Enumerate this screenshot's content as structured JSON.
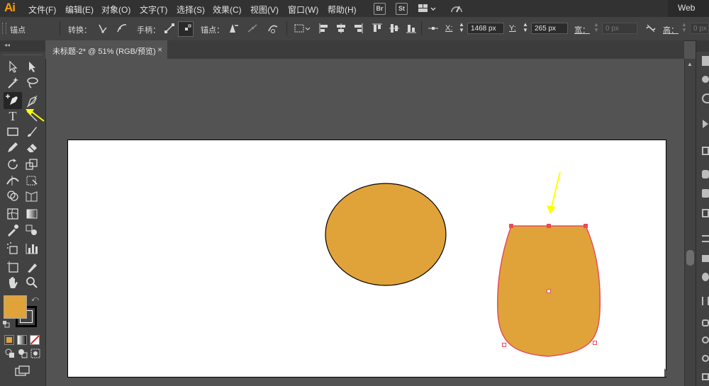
{
  "app": {
    "logo": "Ai",
    "workspace": "Web"
  },
  "menu": [
    "文件(F)",
    "编辑(E)",
    "对象(O)",
    "文字(T)",
    "选择(S)",
    "效果(C)",
    "视图(V)",
    "窗口(W)",
    "帮助(H)"
  ],
  "menubar_icons": {
    "bridge": "Br",
    "stock": "St"
  },
  "control": {
    "selection_label": "锚点",
    "convert_label": "转换：",
    "handles_label": "手柄：",
    "anchors_label": "锚点：",
    "x_label": "X:",
    "x_value": "1468 px",
    "y_label": "Y:",
    "y_value": "265 px",
    "w_label": "宽：",
    "w_value": "0 px",
    "h_label": "高：",
    "h_value": "0 px"
  },
  "document": {
    "tab_title": "未标题-2* @ 51% (RGB/预览)"
  },
  "colors": {
    "fill": "#E0A33A",
    "stroke": "#000000",
    "selection": "#E84B5A",
    "annotation_arrow": "#FFFF00",
    "artboard": "#FFFFFF",
    "canvas": "#535353"
  },
  "icons": {
    "selection": "selection-arrow-icon",
    "direct_selection": "direct-selection-icon",
    "pen": "pen-tool-icon",
    "type": "type-tool-icon",
    "rectangle": "rectangle-tool-icon",
    "brush": "paintbrush-icon",
    "pencil": "pencil-icon",
    "eraser": "eraser-icon",
    "rotate": "rotate-icon",
    "scale": "scale-icon",
    "hand": "hand-icon",
    "zoom": "zoom-icon"
  }
}
